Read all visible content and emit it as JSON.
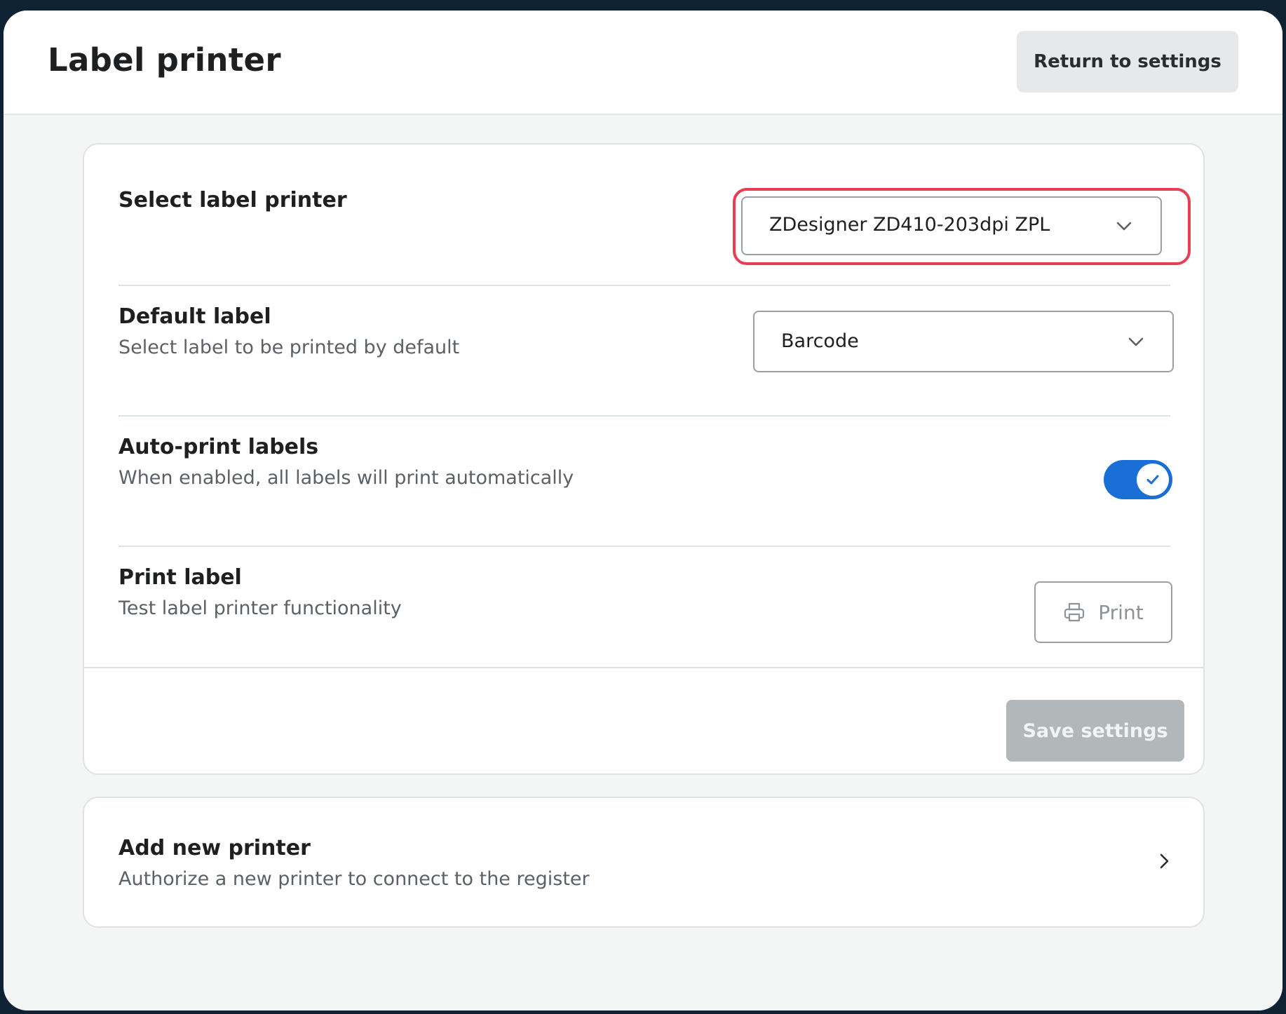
{
  "header": {
    "title": "Label printer",
    "return_label": "Return to settings"
  },
  "settings": {
    "printer": {
      "title": "Select label printer",
      "selected": "ZDesigner ZD410-203dpi ZPL"
    },
    "default_label": {
      "title": "Default label",
      "description": "Select label to be printed by default",
      "selected": "Barcode"
    },
    "auto_print": {
      "title": "Auto-print labels",
      "description": "When enabled, all labels will print automatically",
      "enabled": true
    },
    "print_label": {
      "title": "Print label",
      "description": "Test label printer functionality",
      "button_label": "Print"
    },
    "save_label": "Save settings"
  },
  "add_printer": {
    "title": "Add new printer",
    "description": "Authorize a new printer to connect to the register"
  },
  "colors": {
    "accent": "#1a6fd6",
    "highlight": "#e83e54",
    "disabled_button": "#b2b7ba"
  },
  "icons": {
    "dropdown": "chevron-down-icon",
    "toggle_on": "check-icon",
    "print": "printer-icon",
    "navigate": "chevron-right-icon"
  }
}
